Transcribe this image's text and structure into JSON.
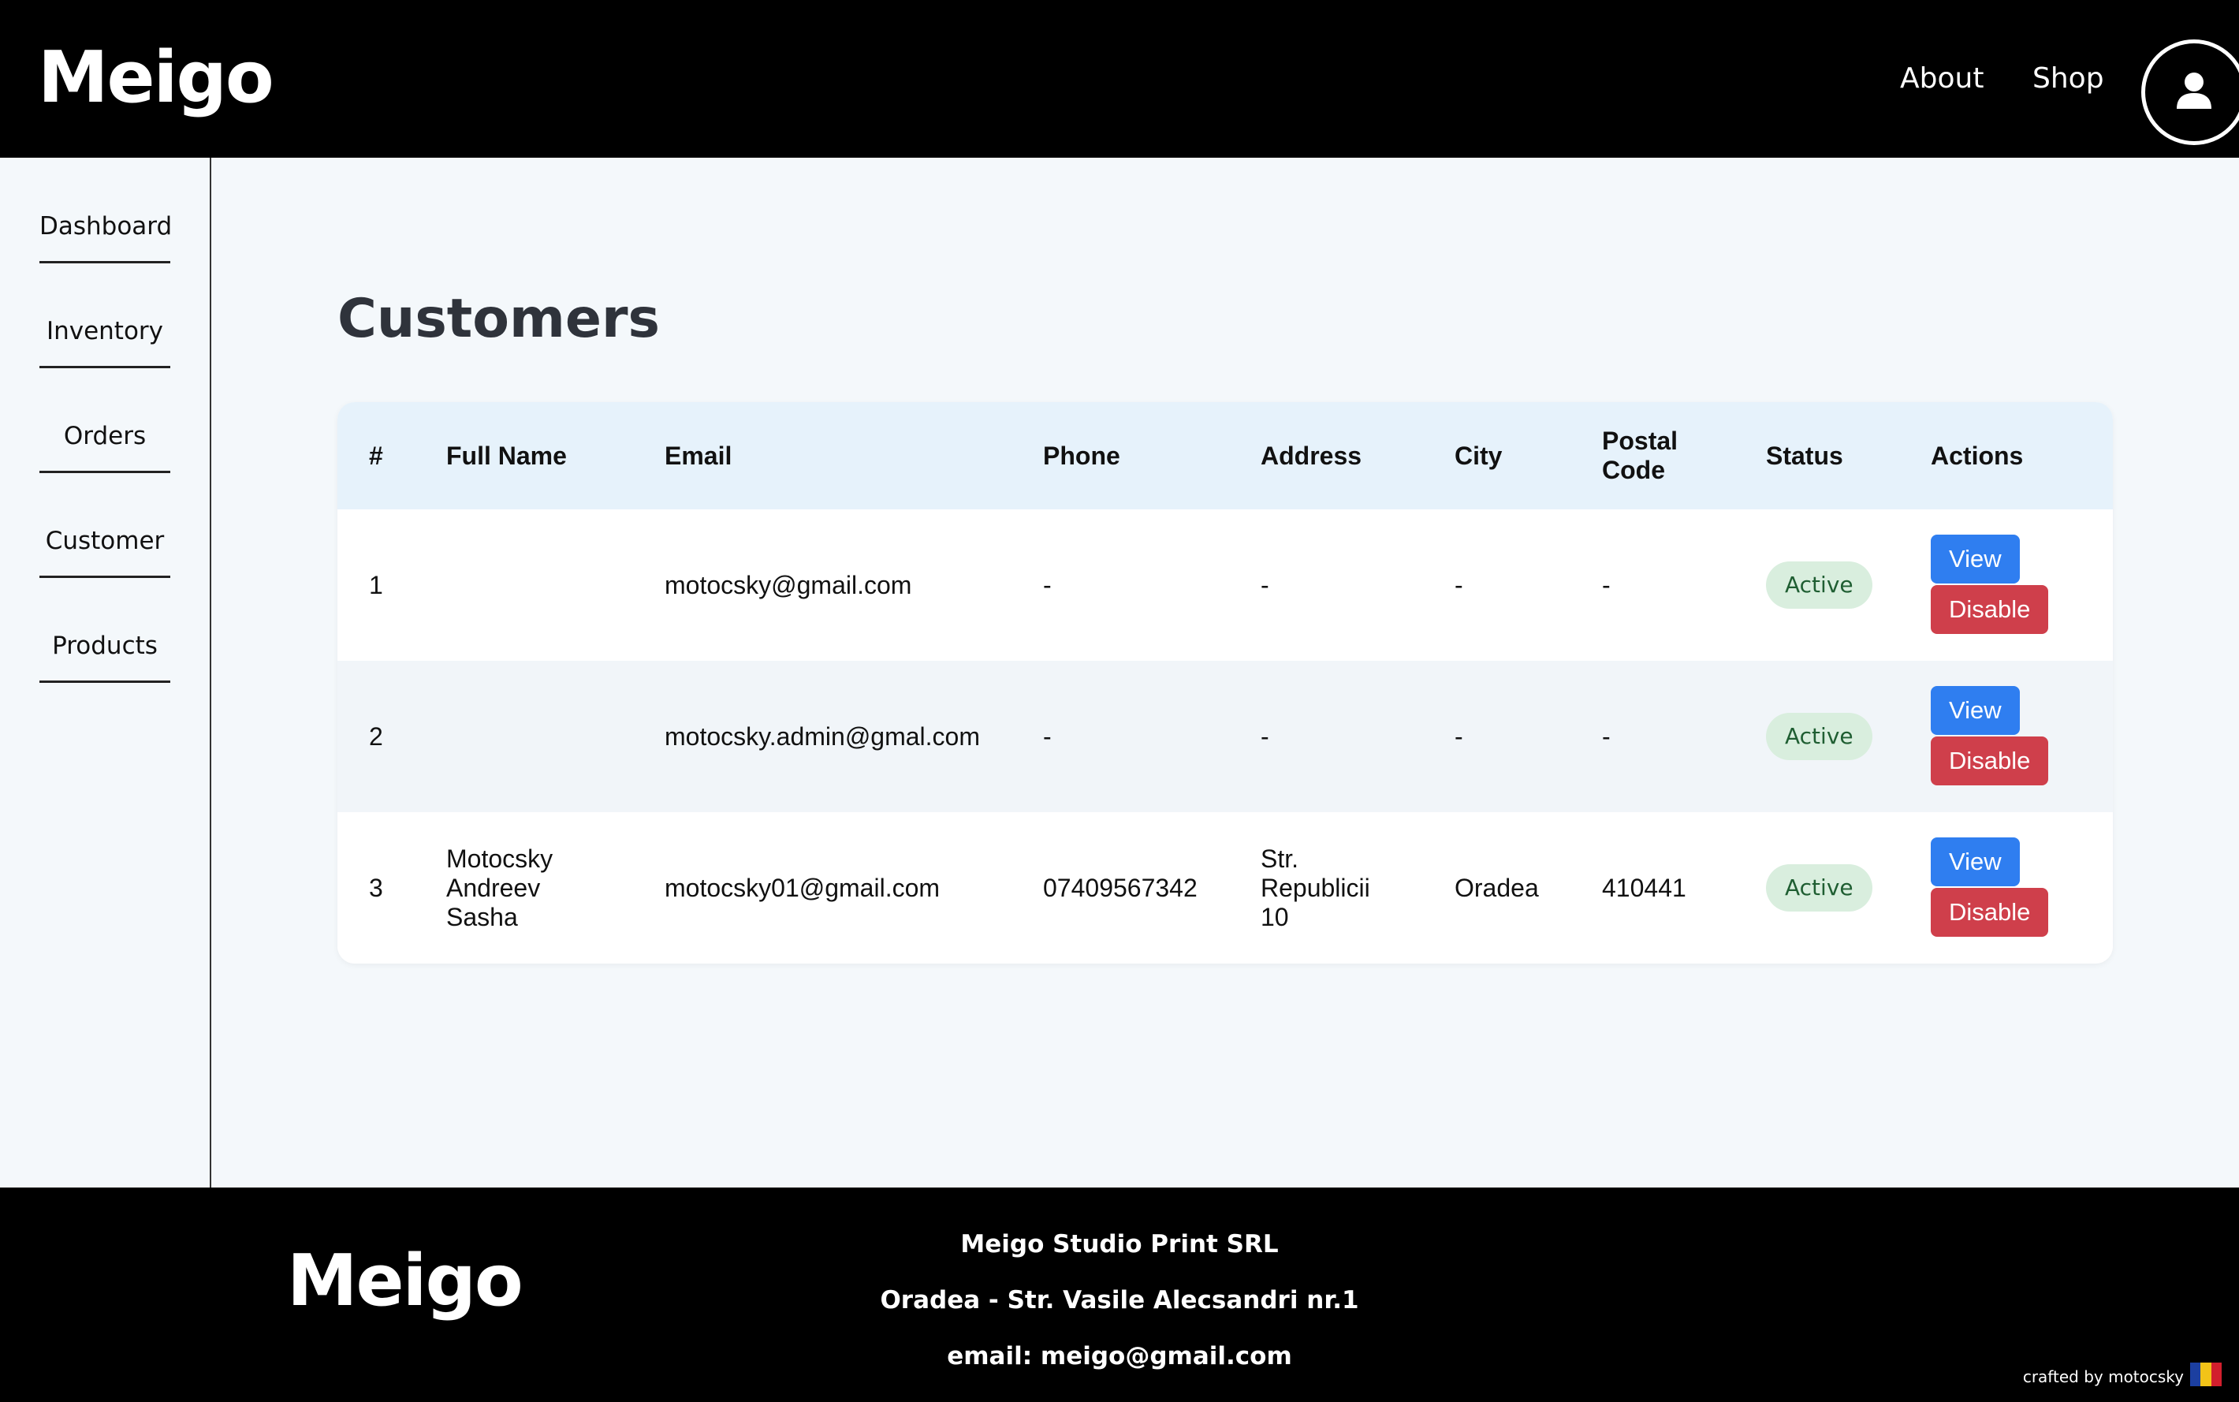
{
  "brand": {
    "logo_text": "Meigo"
  },
  "header": {
    "nav": [
      {
        "label": "About"
      },
      {
        "label": "Shop"
      }
    ]
  },
  "sidebar": {
    "items": [
      {
        "label": "Dashboard"
      },
      {
        "label": "Inventory"
      },
      {
        "label": "Orders"
      },
      {
        "label": "Customer"
      },
      {
        "label": "Products"
      }
    ]
  },
  "main": {
    "title": "Customers",
    "table": {
      "columns": [
        "#",
        "Full Name",
        "Email",
        "Phone",
        "Address",
        "City",
        "Postal Code",
        "Status",
        "Actions"
      ],
      "rows": [
        {
          "id": "1",
          "full_name": "",
          "email": "motocsky@gmail.com",
          "phone": "-",
          "address": "-",
          "city": "-",
          "postal_code": "-",
          "status": "Active",
          "view_label": "View",
          "disable_label": "Disable"
        },
        {
          "id": "2",
          "full_name": "",
          "email": "motocsky.admin@gmal.com",
          "phone": "-",
          "address": "-",
          "city": "-",
          "postal_code": "-",
          "status": "Active",
          "view_label": "View",
          "disable_label": "Disable"
        },
        {
          "id": "3",
          "full_name": "Motocsky Andreev Sasha",
          "email": "motocsky01@gmail.com",
          "phone": "07409567342",
          "address": "Str. Republicii 10",
          "city": "Oradea",
          "postal_code": "410441",
          "status": "Active",
          "view_label": "View",
          "disable_label": "Disable"
        }
      ]
    }
  },
  "footer": {
    "company": "Meigo Studio Print SRL",
    "address": "Oradea - Str. Vasile Alecsandri nr.1",
    "email": "email: meigo@gmail.com",
    "credit": "crafted by motocsky",
    "flag_colors": [
      "#1c3fa0",
      "#f2c318",
      "#d21f2d"
    ]
  },
  "colors": {
    "view_button": "#2f7ef0",
    "disable_button": "#cf3f4b",
    "status_badge_bg": "#d9eede",
    "table_header_bg": "#e6f2fb"
  },
  "icons": {
    "account": "user-circle-icon"
  }
}
